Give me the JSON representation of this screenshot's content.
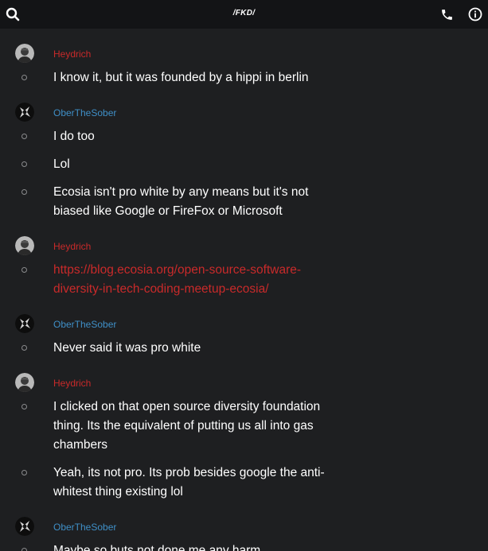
{
  "header": {
    "title": "/FKD/",
    "search_icon": "search-icon",
    "call_icon": "phone-icon",
    "info_icon": "info-icon"
  },
  "colors": {
    "background": "#1e1f21",
    "topbar": "#131416",
    "author_red": "#c92a2a",
    "author_blue": "#3f8fc7",
    "text": "#ffffff"
  },
  "groups": [
    {
      "author": "Heydrich",
      "author_color": "red",
      "messages": [
        "I know it, but it was founded by a hippi in berlin"
      ]
    },
    {
      "author": "OberTheSober",
      "author_color": "blue",
      "messages": [
        "I do too",
        "Lol",
        "Ecosia isn't pro white by any means but it's not biased like Google or FireFox or Microsoft"
      ]
    },
    {
      "author": "Heydrich",
      "author_color": "red",
      "messages": [
        "https://blog.ecosia.org/open-source-software-diversity-in-tech-coding-meetup-ecosia/"
      ]
    },
    {
      "author": "OberTheSober",
      "author_color": "blue",
      "messages": [
        "Never said it was pro white"
      ]
    },
    {
      "author": "Heydrich",
      "author_color": "red",
      "messages": [
        "I clicked on that open source diversity foundation thing. Its the equivalent of putting us all into gas chambers",
        "Yeah, its not pro. Its prob besides google the anti-whitest thing existing lol"
      ]
    },
    {
      "author": "OberTheSober",
      "author_color": "blue",
      "messages": [
        "Maybe so buts not done me any harm"
      ]
    }
  ]
}
